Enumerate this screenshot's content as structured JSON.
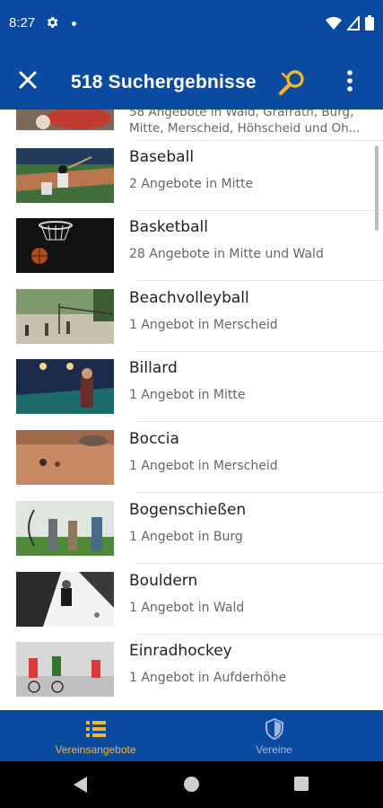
{
  "status": {
    "time": "8:27"
  },
  "appbar": {
    "title": "518 Suchergebnisse"
  },
  "partial_row": {
    "line1": "58 Angebote in Wald, Gräfrath, Burg,",
    "line2": "Mitte, Merscheid, Höhscheid und Oh..."
  },
  "items": [
    {
      "title": "Baseball",
      "subtitle": "2 Angebote in Mitte"
    },
    {
      "title": "Basketball",
      "subtitle": "28 Angebote in Mitte und Wald"
    },
    {
      "title": "Beachvolleyball",
      "subtitle": "1 Angebot in Merscheid"
    },
    {
      "title": "Billard",
      "subtitle": "1 Angebot in Mitte"
    },
    {
      "title": "Boccia",
      "subtitle": "1 Angebot in Merscheid"
    },
    {
      "title": "Bogenschießen",
      "subtitle": "1 Angebot in Burg"
    },
    {
      "title": "Bouldern",
      "subtitle": "1 Angebot in Wald"
    },
    {
      "title": "Einradhockey",
      "subtitle": "1 Angebot in Aufderhöhe"
    }
  ],
  "nav": {
    "tab1": "Vereinsangebote",
    "tab2": "Vereine",
    "active_color": "#f2b531",
    "inactive_color": "#9fb8dc"
  },
  "colors": {
    "primary": "#0a4aa0",
    "accent": "#f2b531"
  }
}
